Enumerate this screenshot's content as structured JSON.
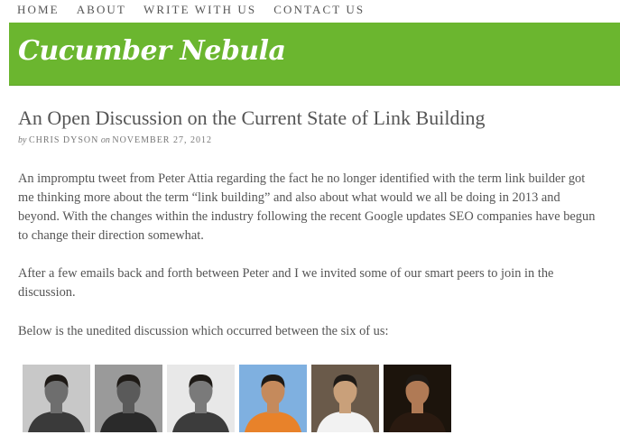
{
  "nav": {
    "items": [
      "HOME",
      "ABOUT",
      "WRITE WITH US",
      "CONTACT US"
    ]
  },
  "site": {
    "title": "Cucumber Nebula",
    "brand_color": "#6bb62f"
  },
  "post": {
    "title": "An Open Discussion on the Current State of Link Building",
    "byline": {
      "by_word": "by",
      "author": "CHRIS DYSON",
      "on_word": "on",
      "date": "NOVEMBER 27, 2012"
    },
    "paragraphs": [
      "An impromptu tweet from Peter Attia regarding the fact he no longer identified with the term link builder got me thinking more about the term “link building” and also about what would we all be doing in 2013 and beyond. With the changes within the industry following the recent Google updates SEO companies have begun to change their direction somewhat.",
      "After a few emails back and forth between Peter and I we invited some of our smart peers to join in the discussion.",
      "Below is the unedited discussion which occurred between the six of us:"
    ],
    "avatars": [
      {
        "name": "participant-photo-1",
        "bg": "#c8c8c8",
        "face": "#6e6e6e",
        "shirt": "#3a3a3a"
      },
      {
        "name": "participant-photo-2",
        "bg": "#9a9a9a",
        "face": "#5a5a5a",
        "shirt": "#2a2a2a"
      },
      {
        "name": "participant-photo-3",
        "bg": "#e8e8e8",
        "face": "#7a7a7a",
        "shirt": "#3c3c3c"
      },
      {
        "name": "participant-photo-4",
        "bg": "#7fb0e0",
        "face": "#c58a5c",
        "shirt": "#e8822a"
      },
      {
        "name": "participant-photo-5",
        "bg": "#6a5a4a",
        "face": "#c9a07a",
        "shirt": "#f2f2f2"
      },
      {
        "name": "participant-photo-6",
        "bg": "#1c140c",
        "face": "#b07a55",
        "shirt": "#2a1a10"
      }
    ]
  }
}
